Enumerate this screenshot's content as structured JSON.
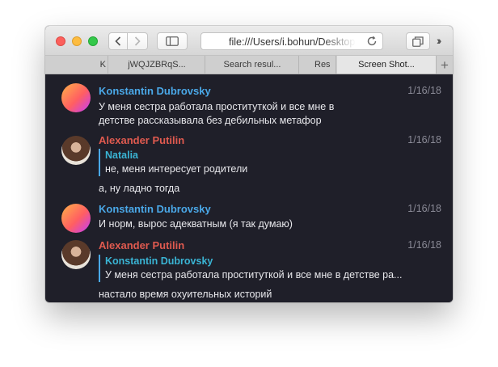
{
  "toolbar": {
    "url": "file:///Users/i.bohun/Desktop/"
  },
  "tabs": [
    {
      "label": "K"
    },
    {
      "label": "jWQJZBRqS..."
    },
    {
      "label": "Search resul..."
    },
    {
      "label": "Res"
    },
    {
      "label": "Screen Shot..."
    }
  ],
  "messages": [
    {
      "author": "Konstantin Dubrovsky",
      "date": "1/16/18",
      "lines": [
        "У меня сестра работала проституткой и все мне в",
        "детстве рассказывала без дебильных метафор"
      ]
    },
    {
      "author": "Alexander Putilin",
      "date": "1/16/18",
      "quote_author": "Natalia",
      "quote_text": "не, меня интересует родители",
      "text": "а, ну ладно тогда"
    },
    {
      "author": "Konstantin Dubrovsky",
      "date": "1/16/18",
      "text": "И норм, вырос адекватным (я так думаю)"
    },
    {
      "author": "Alexander Putilin",
      "date": "1/16/18",
      "quote_author": "Konstantin Dubrovsky",
      "quote_text": "У меня сестра работала проституткой и все мне в детстве ра...",
      "text": "настало время охуительных историй"
    }
  ],
  "colors": {
    "background": "#1f1f29",
    "author_blue": "#4aa8e8",
    "author_red": "#e05a4f",
    "quote_bar": "#4aa8e8"
  },
  "icons": [
    "back-chevron-icon",
    "forward-chevron-icon",
    "sidebar-icon",
    "reload-icon",
    "tabs-overview-icon",
    "more-chevrons-icon",
    "new-tab-plus-icon"
  ]
}
